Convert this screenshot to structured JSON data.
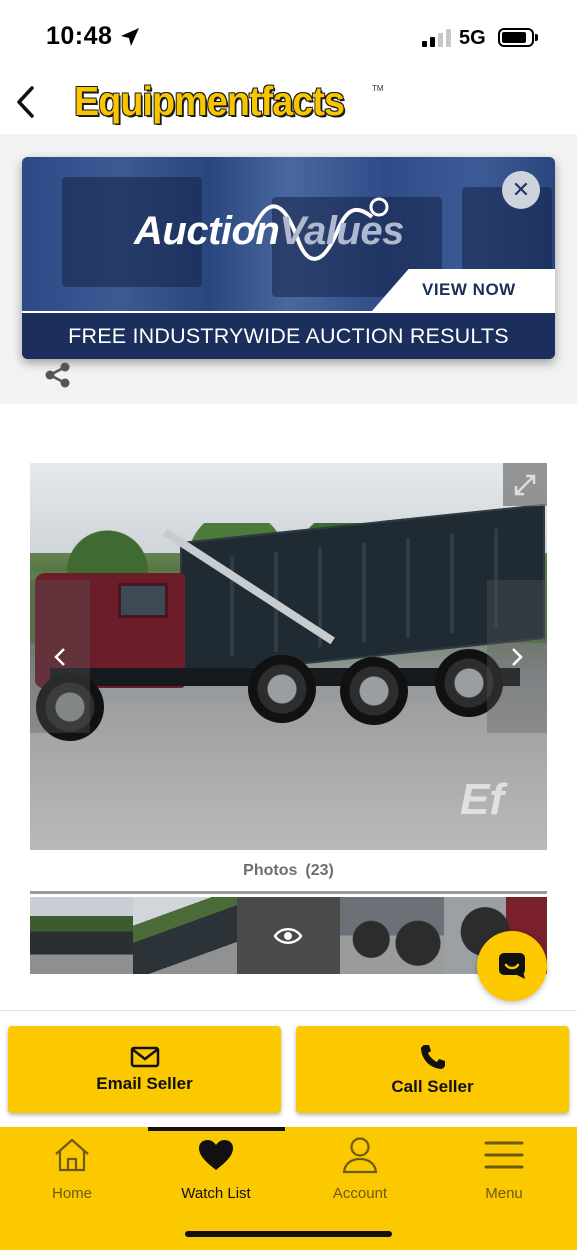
{
  "status_bar": {
    "time": "10:48",
    "network": "5G"
  },
  "header": {
    "brand": "Equipmentfacts",
    "brand_tm": "TM"
  },
  "ad": {
    "logo_part1": "Auction",
    "logo_part2": "Values",
    "cta": "VIEW NOW",
    "footer": "FREE INDUSTRYWIDE AUCTION RESULTS",
    "close_glyph": "✕"
  },
  "photo": {
    "watermark": "Ef"
  },
  "gallery": {
    "label": "Photos",
    "count": "(23)"
  },
  "actions": {
    "email_label": "Email Seller",
    "call_label": "Call Seller"
  },
  "bottom_nav": {
    "items": [
      {
        "label": "Home",
        "icon": "home-icon"
      },
      {
        "label": "Watch List",
        "icon": "heart-icon"
      },
      {
        "label": "Account",
        "icon": "person-icon"
      },
      {
        "label": "Menu",
        "icon": "hamburger-icon"
      }
    ],
    "active_index": 1
  },
  "colors": {
    "brand_yellow": "#fcc800",
    "ad_navy": "#1c2f5c"
  }
}
